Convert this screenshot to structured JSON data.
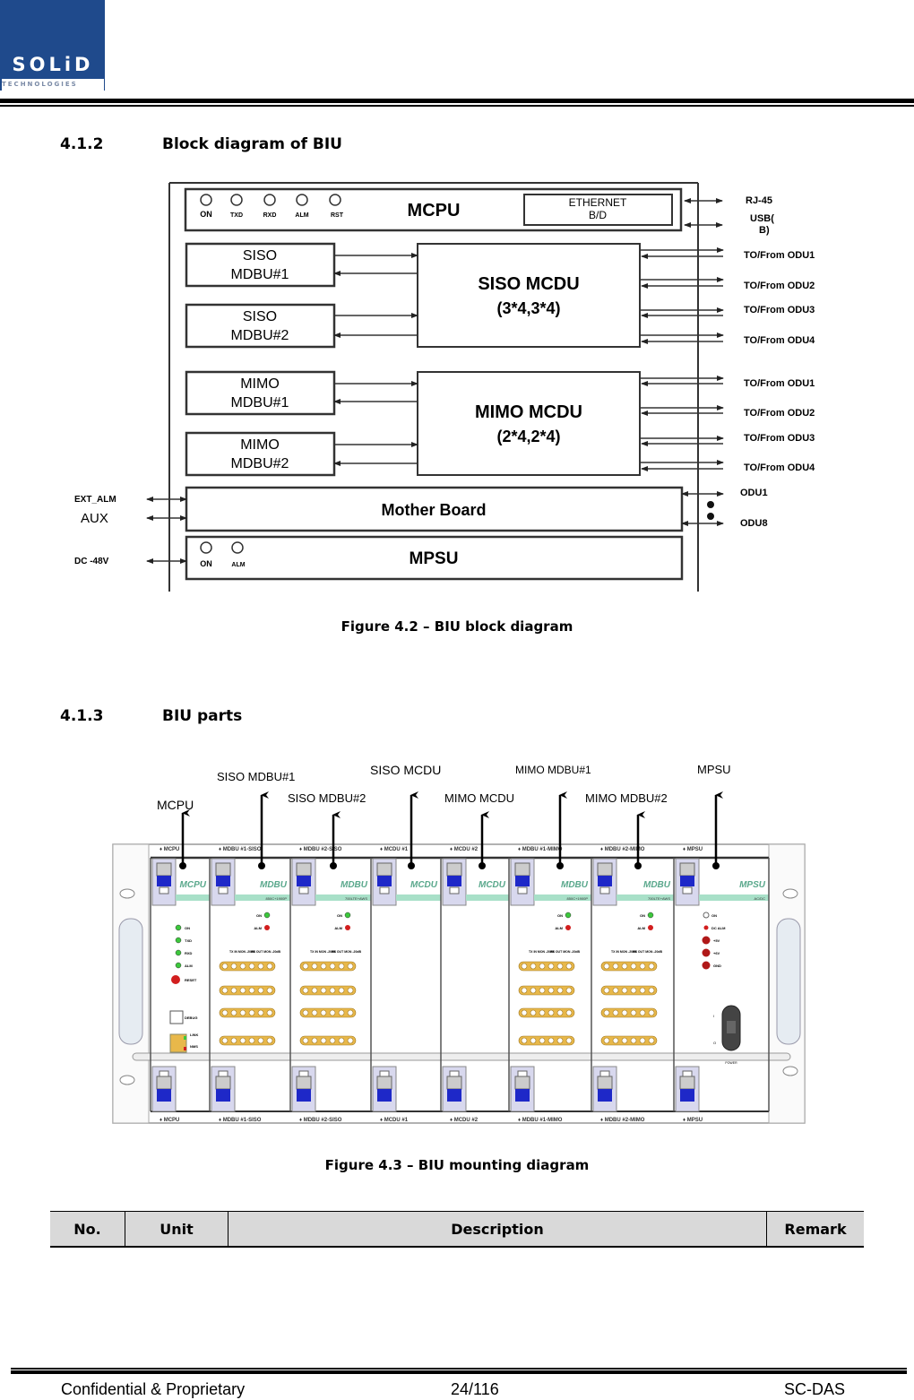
{
  "header": {
    "logo_text": "SOLiD",
    "logo_subtext": "TECHNOLOGIES",
    "logo_color": "#1f4a8c"
  },
  "sections": [
    {
      "number": "4.1.2",
      "title": "Block diagram of BIU"
    },
    {
      "number": "4.1.3",
      "title": "BIU parts"
    }
  ],
  "block_diagram": {
    "mcpu": {
      "label": "MCPU",
      "leds": [
        "ON",
        "TXD",
        "RXD",
        "ALM",
        "RST"
      ],
      "ethernet_label_1": "ETHERNET",
      "ethernet_label_2": "B/D"
    },
    "external_ports_top": [
      "RJ-45",
      "USB(",
      "B)"
    ],
    "siso_mdbu": [
      {
        "line1": "SISO",
        "line2": "MDBU#1"
      },
      {
        "line1": "SISO",
        "line2": "MDBU#2"
      }
    ],
    "mimo_mdbu": [
      {
        "line1": "MIMO",
        "line2": "MDBU#1"
      },
      {
        "line1": "MIMO",
        "line2": "MDBU#2"
      }
    ],
    "siso_mcdu": {
      "line1": "SISO MCDU",
      "line2": "(3*4,3*4)"
    },
    "mimo_mcdu": {
      "line1": "MIMO MCDU",
      "line2": "(2*4,2*4)"
    },
    "siso_outputs": [
      "TO/From ODU1",
      "TO/From ODU2",
      "TO/From ODU3",
      "TO/From ODU4"
    ],
    "mimo_outputs": [
      "TO/From ODU1",
      "TO/From ODU2",
      "TO/From ODU3",
      "TO/From ODU4"
    ],
    "mother_board": {
      "label": "Mother Board",
      "outputs": [
        "ODU1",
        "ODU8"
      ]
    },
    "mpsu": {
      "label": "MPSU",
      "leds": [
        "ON",
        "ALM"
      ]
    },
    "left_ports": [
      "EXT_ALM",
      "AUX",
      "DC -48V"
    ]
  },
  "figures": {
    "fig_4_2": "Figure 4.2 – BIU block diagram",
    "fig_4_3": "Figure 4.3 – BIU mounting diagram"
  },
  "mounting_diagram": {
    "callouts": [
      "MCPU",
      "SISO MDBU#1",
      "SISO MDBU#2",
      "SISO  MCDU",
      "MIMO MCDU",
      "MIMO MDBU#1",
      "MIMO MDBU#2",
      "MPSU"
    ],
    "slot_labels": [
      "♦ MCPU",
      "♦ MDBU #1-SISO",
      "♦ MDBU #2-SISO",
      "♦ MCDU #1",
      "♦ MCDU #2",
      "♦ MDBU #1-MIMO",
      "♦ MDBU #2-MIMO",
      "♦ MPSU"
    ],
    "module_names": [
      "MCPU",
      "MDBU",
      "MDBU",
      "MCDU",
      "MCDU",
      "MDBU",
      "MDBU",
      "MPSU"
    ],
    "module_subtitles": [
      "",
      "850C+1900P",
      "700LTE+AWS",
      "",
      "",
      "850C+1900P",
      "700LTE+AWS",
      "AC/DC"
    ],
    "mcpu_leds": [
      "ON",
      "TXD",
      "RXD",
      "ALM",
      "RESET"
    ],
    "mcpu_ports": [
      "DEBUG",
      "LINK",
      "NMS"
    ],
    "mdbu_leds": [
      "ON",
      "ALM"
    ],
    "mdbu_port_headers": [
      "TX IN MON -20dB",
      "RX OUT MON -20dB"
    ],
    "mpsu_leds": [
      "ON",
      "DC ALM",
      "+5V",
      "+6V",
      "GND"
    ],
    "mpsu_switch_label": "POWER",
    "led_colors": {
      "green": "#3cc83c",
      "red": "#d21e1e",
      "module_text": "#5aa88c",
      "slot_strip": "#a8e0c8",
      "handle": "#d8d8ee",
      "blue": "#1e28c8",
      "connector": "#e8b84a"
    }
  },
  "table": {
    "headers": [
      "No.",
      "Unit",
      "Description",
      "Remark"
    ]
  },
  "footer": {
    "left": "Confidential & Proprietary",
    "center": "24/116",
    "right": "SC-DAS"
  }
}
